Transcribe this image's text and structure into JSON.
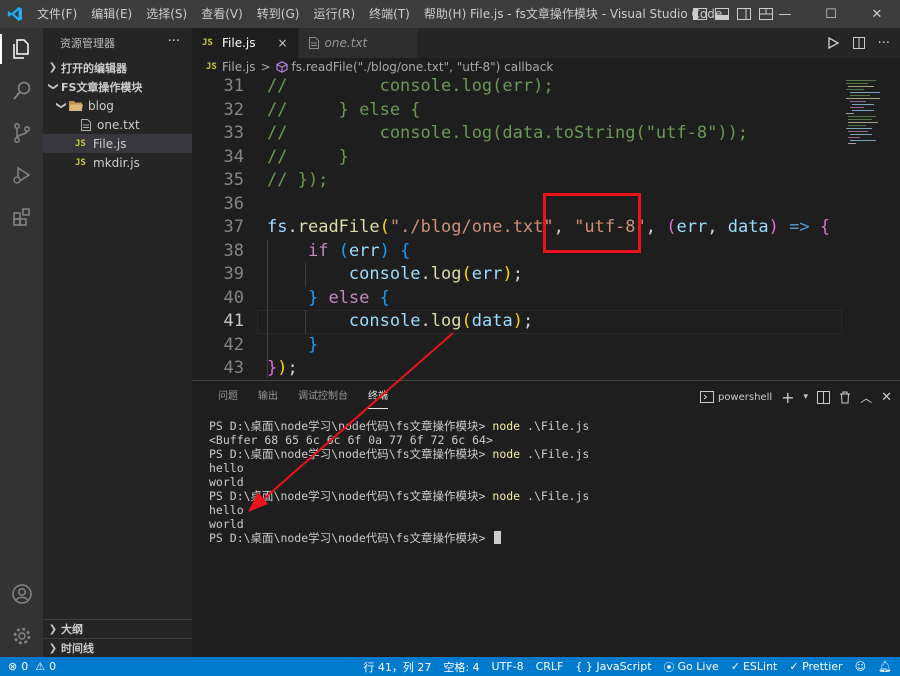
{
  "titlebar": {
    "menu": [
      "文件(F)",
      "编辑(E)",
      "选择(S)",
      "查看(V)",
      "转到(G)",
      "运行(R)",
      "终端(T)",
      "帮助(H)"
    ],
    "window_title": "File.js - fs文章操作模块 - Visual Studio Code"
  },
  "sidebar": {
    "title": "资源管理器",
    "more": "···",
    "open_editors": "打开的编辑器",
    "folder": "FS文章操作模块",
    "items": [
      {
        "name": "blog",
        "kind": "folder"
      },
      {
        "name": "one.txt",
        "kind": "txt"
      },
      {
        "name": "File.js",
        "kind": "js"
      },
      {
        "name": "mkdir.js",
        "kind": "js"
      }
    ],
    "js_badge": "JS",
    "outline": "大纲",
    "timeline": "时间线"
  },
  "tabs": [
    {
      "label": "File.js",
      "active": true,
      "close": "×"
    },
    {
      "label": "one.txt",
      "active": false
    }
  ],
  "breadcrumb": {
    "file": "File.js",
    "sep": ">",
    "symbol": "fs.readFile(\"./blog/one.txt\", \"utf-8\") callback"
  },
  "code": {
    "current_line": 41,
    "lines": [
      {
        "n": "31",
        "tokens": [
          {
            "t": "//         console.log(err);",
            "c": "cm"
          }
        ]
      },
      {
        "n": "32",
        "tokens": [
          {
            "t": "//     } else {",
            "c": "cm"
          }
        ]
      },
      {
        "n": "33",
        "tokens": [
          {
            "t": "//         console.log(data.toString(\"utf-8\"));",
            "c": "cm"
          }
        ]
      },
      {
        "n": "34",
        "tokens": [
          {
            "t": "//     }",
            "c": "cm"
          }
        ]
      },
      {
        "n": "35",
        "tokens": [
          {
            "t": "// });",
            "c": "cm"
          }
        ]
      },
      {
        "n": "36",
        "tokens": []
      },
      {
        "n": "37",
        "tokens": [
          {
            "t": "fs",
            "c": "var"
          },
          {
            "t": ".",
            "c": "pun"
          },
          {
            "t": "readFile",
            "c": "fn"
          },
          {
            "t": "(",
            "c": "b1"
          },
          {
            "t": "\"./blog/one.txt\"",
            "c": "str"
          },
          {
            "t": ", ",
            "c": "pun"
          },
          {
            "t": "\"utf-8\"",
            "c": "str"
          },
          {
            "t": ", ",
            "c": "pun"
          },
          {
            "t": "(",
            "c": "b2"
          },
          {
            "t": "err",
            "c": "var"
          },
          {
            "t": ", ",
            "c": "pun"
          },
          {
            "t": "data",
            "c": "var"
          },
          {
            "t": ")",
            "c": "b2"
          },
          {
            "t": " ",
            "c": "pun"
          },
          {
            "t": "=>",
            "c": "kb"
          },
          {
            "t": " ",
            "c": "pun"
          },
          {
            "t": "{",
            "c": "b2"
          }
        ]
      },
      {
        "n": "38",
        "tokens": [
          {
            "t": "    ",
            "c": "pun"
          },
          {
            "t": "if",
            "c": "kw"
          },
          {
            "t": " ",
            "c": "pun"
          },
          {
            "t": "(",
            "c": "b3"
          },
          {
            "t": "err",
            "c": "var"
          },
          {
            "t": ")",
            "c": "b3"
          },
          {
            "t": " ",
            "c": "pun"
          },
          {
            "t": "{",
            "c": "b3"
          }
        ]
      },
      {
        "n": "39",
        "tokens": [
          {
            "t": "        ",
            "c": "pun"
          },
          {
            "t": "console",
            "c": "var"
          },
          {
            "t": ".",
            "c": "pun"
          },
          {
            "t": "log",
            "c": "fn"
          },
          {
            "t": "(",
            "c": "b1"
          },
          {
            "t": "err",
            "c": "var"
          },
          {
            "t": ")",
            "c": "b1"
          },
          {
            "t": ";",
            "c": "pun"
          }
        ]
      },
      {
        "n": "40",
        "tokens": [
          {
            "t": "    ",
            "c": "pun"
          },
          {
            "t": "}",
            "c": "b3"
          },
          {
            "t": " ",
            "c": "pun"
          },
          {
            "t": "else",
            "c": "kw"
          },
          {
            "t": " ",
            "c": "pun"
          },
          {
            "t": "{",
            "c": "b3"
          }
        ]
      },
      {
        "n": "41",
        "tokens": [
          {
            "t": "        ",
            "c": "pun"
          },
          {
            "t": "console",
            "c": "var"
          },
          {
            "t": ".",
            "c": "pun"
          },
          {
            "t": "log",
            "c": "fn"
          },
          {
            "t": "(",
            "c": "b1"
          },
          {
            "t": "data",
            "c": "var"
          },
          {
            "t": ")",
            "c": "b1"
          },
          {
            "t": ";",
            "c": "pun"
          }
        ]
      },
      {
        "n": "42",
        "tokens": [
          {
            "t": "    ",
            "c": "pun"
          },
          {
            "t": "}",
            "c": "b3"
          }
        ]
      },
      {
        "n": "43",
        "tokens": [
          {
            "t": "}",
            "c": "b2"
          },
          {
            "t": ")",
            "c": "b1"
          },
          {
            "t": ";",
            "c": "pun"
          }
        ]
      }
    ]
  },
  "panel": {
    "tabs": [
      "问题",
      "输出",
      "调试控制台",
      "终端"
    ],
    "active_tab": "终端",
    "shell": "powershell",
    "terminal": [
      {
        "prompt": "PS D:\\桌面\\node学习\\node代码\\fs文章操作模块> ",
        "cmd": "node",
        "rest": " .\\File.js"
      },
      {
        "text": "<Buffer 68 65 6c 6c 6f 0a 77 6f 72 6c 64>"
      },
      {
        "prompt": "PS D:\\桌面\\node学习\\node代码\\fs文章操作模块> ",
        "cmd": "node",
        "rest": " .\\File.js"
      },
      {
        "text": "hello"
      },
      {
        "text": "world"
      },
      {
        "prompt": "PS D:\\桌面\\node学习\\node代码\\fs文章操作模块> ",
        "cmd": "node",
        "rest": " .\\File.js"
      },
      {
        "text": "hello"
      },
      {
        "text": "world"
      },
      {
        "prompt": "PS D:\\桌面\\node学习\\node代码\\fs文章操作模块> ",
        "cursor": true
      }
    ]
  },
  "statusbar": {
    "errors": "0",
    "warnings": "0",
    "position": "行 41，列 27",
    "spaces": "空格: 4",
    "encoding": "UTF-8",
    "eol": "CRLF",
    "language": "{ } JavaScript",
    "golive": "Go Live",
    "eslint": "ESLint",
    "prettier": "✓ Prettier"
  },
  "colors": {
    "accent": "#007acc",
    "annotation": "#e8131b"
  }
}
